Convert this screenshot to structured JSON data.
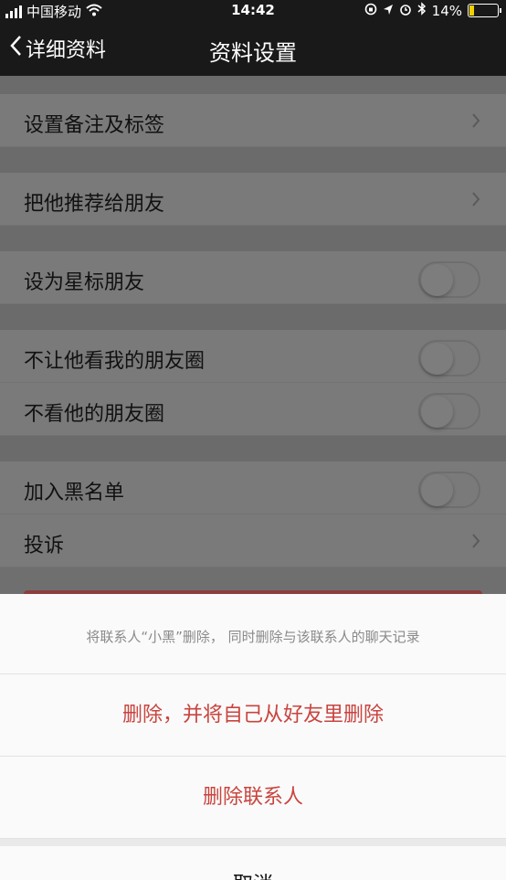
{
  "status": {
    "carrier": "中国移动",
    "time": "14:42",
    "battery": "14%"
  },
  "nav": {
    "back_label": "详细资料",
    "title": "资料设置"
  },
  "settings": {
    "remark": "设置备注及标签",
    "recommend": "把他推荐给朋友",
    "star": "设为星标朋友",
    "hide_moments": "不让他看我的朋友圈",
    "ignore_moments": "不看他的朋友圈",
    "blacklist": "加入黑名单",
    "report": "投诉"
  },
  "toggles": {
    "star": false,
    "hide_moments": false,
    "ignore_moments": false,
    "blacklist": false
  },
  "sheet": {
    "message": "将联系人“小黑”删除， 同时删除与该联系人的聊天记录",
    "delete_both": "删除，并将自己从好友里删除",
    "delete_contact": "删除联系人",
    "cancel": "取消"
  },
  "colors": {
    "nav_bg": "#191919",
    "destructive": "#c9443e",
    "battery_fill": "#f0d000"
  }
}
